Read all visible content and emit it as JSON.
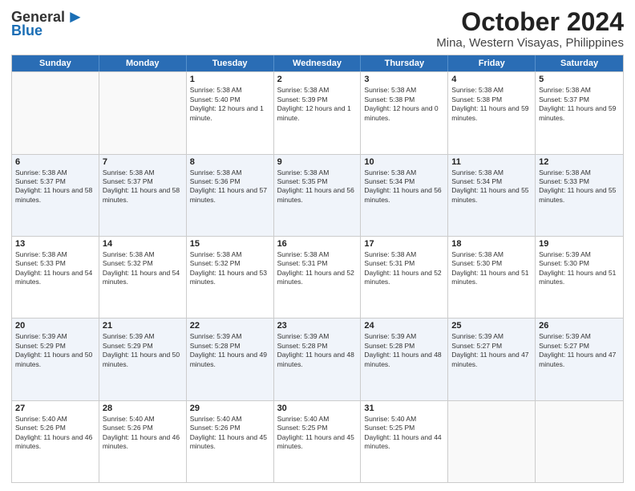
{
  "logo": {
    "line1": "General",
    "line2": "Blue"
  },
  "title": "October 2024",
  "subtitle": "Mina, Western Visayas, Philippines",
  "days": [
    "Sunday",
    "Monday",
    "Tuesday",
    "Wednesday",
    "Thursday",
    "Friday",
    "Saturday"
  ],
  "weeks": [
    [
      {
        "day": "",
        "sunrise": "",
        "sunset": "",
        "daylight": ""
      },
      {
        "day": "",
        "sunrise": "",
        "sunset": "",
        "daylight": ""
      },
      {
        "day": "1",
        "sunrise": "Sunrise: 5:38 AM",
        "sunset": "Sunset: 5:40 PM",
        "daylight": "Daylight: 12 hours and 1 minute."
      },
      {
        "day": "2",
        "sunrise": "Sunrise: 5:38 AM",
        "sunset": "Sunset: 5:39 PM",
        "daylight": "Daylight: 12 hours and 1 minute."
      },
      {
        "day": "3",
        "sunrise": "Sunrise: 5:38 AM",
        "sunset": "Sunset: 5:38 PM",
        "daylight": "Daylight: 12 hours and 0 minutes."
      },
      {
        "day": "4",
        "sunrise": "Sunrise: 5:38 AM",
        "sunset": "Sunset: 5:38 PM",
        "daylight": "Daylight: 11 hours and 59 minutes."
      },
      {
        "day": "5",
        "sunrise": "Sunrise: 5:38 AM",
        "sunset": "Sunset: 5:37 PM",
        "daylight": "Daylight: 11 hours and 59 minutes."
      }
    ],
    [
      {
        "day": "6",
        "sunrise": "Sunrise: 5:38 AM",
        "sunset": "Sunset: 5:37 PM",
        "daylight": "Daylight: 11 hours and 58 minutes."
      },
      {
        "day": "7",
        "sunrise": "Sunrise: 5:38 AM",
        "sunset": "Sunset: 5:37 PM",
        "daylight": "Daylight: 11 hours and 58 minutes."
      },
      {
        "day": "8",
        "sunrise": "Sunrise: 5:38 AM",
        "sunset": "Sunset: 5:36 PM",
        "daylight": "Daylight: 11 hours and 57 minutes."
      },
      {
        "day": "9",
        "sunrise": "Sunrise: 5:38 AM",
        "sunset": "Sunset: 5:35 PM",
        "daylight": "Daylight: 11 hours and 56 minutes."
      },
      {
        "day": "10",
        "sunrise": "Sunrise: 5:38 AM",
        "sunset": "Sunset: 5:34 PM",
        "daylight": "Daylight: 11 hours and 56 minutes."
      },
      {
        "day": "11",
        "sunrise": "Sunrise: 5:38 AM",
        "sunset": "Sunset: 5:34 PM",
        "daylight": "Daylight: 11 hours and 55 minutes."
      },
      {
        "day": "12",
        "sunrise": "Sunrise: 5:38 AM",
        "sunset": "Sunset: 5:33 PM",
        "daylight": "Daylight: 11 hours and 55 minutes."
      }
    ],
    [
      {
        "day": "13",
        "sunrise": "Sunrise: 5:38 AM",
        "sunset": "Sunset: 5:33 PM",
        "daylight": "Daylight: 11 hours and 54 minutes."
      },
      {
        "day": "14",
        "sunrise": "Sunrise: 5:38 AM",
        "sunset": "Sunset: 5:32 PM",
        "daylight": "Daylight: 11 hours and 54 minutes."
      },
      {
        "day": "15",
        "sunrise": "Sunrise: 5:38 AM",
        "sunset": "Sunset: 5:32 PM",
        "daylight": "Daylight: 11 hours and 53 minutes."
      },
      {
        "day": "16",
        "sunrise": "Sunrise: 5:38 AM",
        "sunset": "Sunset: 5:31 PM",
        "daylight": "Daylight: 11 hours and 52 minutes."
      },
      {
        "day": "17",
        "sunrise": "Sunrise: 5:38 AM",
        "sunset": "Sunset: 5:31 PM",
        "daylight": "Daylight: 11 hours and 52 minutes."
      },
      {
        "day": "18",
        "sunrise": "Sunrise: 5:38 AM",
        "sunset": "Sunset: 5:30 PM",
        "daylight": "Daylight: 11 hours and 51 minutes."
      },
      {
        "day": "19",
        "sunrise": "Sunrise: 5:39 AM",
        "sunset": "Sunset: 5:30 PM",
        "daylight": "Daylight: 11 hours and 51 minutes."
      }
    ],
    [
      {
        "day": "20",
        "sunrise": "Sunrise: 5:39 AM",
        "sunset": "Sunset: 5:29 PM",
        "daylight": "Daylight: 11 hours and 50 minutes."
      },
      {
        "day": "21",
        "sunrise": "Sunrise: 5:39 AM",
        "sunset": "Sunset: 5:29 PM",
        "daylight": "Daylight: 11 hours and 50 minutes."
      },
      {
        "day": "22",
        "sunrise": "Sunrise: 5:39 AM",
        "sunset": "Sunset: 5:28 PM",
        "daylight": "Daylight: 11 hours and 49 minutes."
      },
      {
        "day": "23",
        "sunrise": "Sunrise: 5:39 AM",
        "sunset": "Sunset: 5:28 PM",
        "daylight": "Daylight: 11 hours and 48 minutes."
      },
      {
        "day": "24",
        "sunrise": "Sunrise: 5:39 AM",
        "sunset": "Sunset: 5:28 PM",
        "daylight": "Daylight: 11 hours and 48 minutes."
      },
      {
        "day": "25",
        "sunrise": "Sunrise: 5:39 AM",
        "sunset": "Sunset: 5:27 PM",
        "daylight": "Daylight: 11 hours and 47 minutes."
      },
      {
        "day": "26",
        "sunrise": "Sunrise: 5:39 AM",
        "sunset": "Sunset: 5:27 PM",
        "daylight": "Daylight: 11 hours and 47 minutes."
      }
    ],
    [
      {
        "day": "27",
        "sunrise": "Sunrise: 5:40 AM",
        "sunset": "Sunset: 5:26 PM",
        "daylight": "Daylight: 11 hours and 46 minutes."
      },
      {
        "day": "28",
        "sunrise": "Sunrise: 5:40 AM",
        "sunset": "Sunset: 5:26 PM",
        "daylight": "Daylight: 11 hours and 46 minutes."
      },
      {
        "day": "29",
        "sunrise": "Sunrise: 5:40 AM",
        "sunset": "Sunset: 5:26 PM",
        "daylight": "Daylight: 11 hours and 45 minutes."
      },
      {
        "day": "30",
        "sunrise": "Sunrise: 5:40 AM",
        "sunset": "Sunset: 5:25 PM",
        "daylight": "Daylight: 11 hours and 45 minutes."
      },
      {
        "day": "31",
        "sunrise": "Sunrise: 5:40 AM",
        "sunset": "Sunset: 5:25 PM",
        "daylight": "Daylight: 11 hours and 44 minutes."
      },
      {
        "day": "",
        "sunrise": "",
        "sunset": "",
        "daylight": ""
      },
      {
        "day": "",
        "sunrise": "",
        "sunset": "",
        "daylight": ""
      }
    ]
  ]
}
